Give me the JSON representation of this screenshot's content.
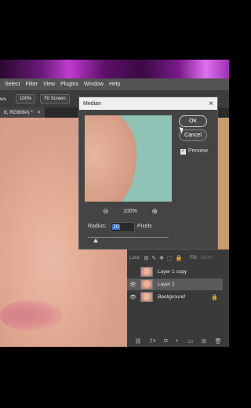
{
  "menu": [
    "Select",
    "Filter",
    "View",
    "Plugins",
    "Window",
    "Help"
  ],
  "options": {
    "prefix": "ws",
    "zoom": "100%",
    "fit": "Fit Screen"
  },
  "tab": {
    "title": "8, RGB/8#) *",
    "close": "×"
  },
  "dialog": {
    "title": "Median",
    "close": "×",
    "ok": "OK",
    "cancel": "Cancel",
    "preview_label": "Preview",
    "preview_checked": true,
    "zoom_out": "⊖",
    "zoom_level": "100%",
    "zoom_in": "⊕",
    "radius_label": "Radius:",
    "radius_value": "20",
    "radius_units": "Pixels"
  },
  "layers_panel": {
    "lock_label": "Lock:",
    "fill_label": "Fill:",
    "fill_value": "100%",
    "layers": [
      {
        "name": "Layer 1 copy",
        "visible": false,
        "selected": false
      },
      {
        "name": "Layer 1",
        "visible": true,
        "selected": true
      },
      {
        "name": "Background",
        "visible": true,
        "selected": false,
        "locked": true
      }
    ]
  },
  "bottom_icons": [
    "link-icon",
    "fx-icon",
    "mask-icon",
    "adjustment-icon",
    "folder-icon",
    "new-layer-icon",
    "trash-icon"
  ]
}
